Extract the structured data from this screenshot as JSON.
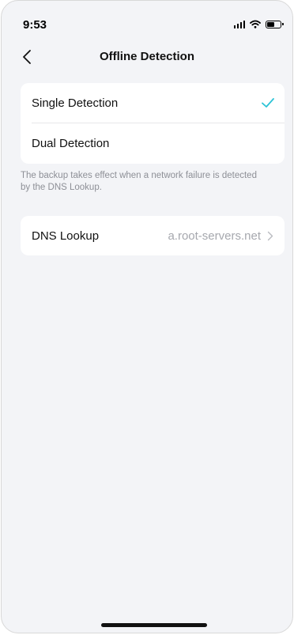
{
  "status_bar": {
    "time": "9:53",
    "icons": [
      "signal-icon",
      "wifi-icon",
      "battery-icon"
    ]
  },
  "nav": {
    "back_icon": "chevron-left-icon",
    "title": "Offline Detection"
  },
  "detection_modes": {
    "items": [
      {
        "label": "Single Detection",
        "selected": true
      },
      {
        "label": "Dual Detection",
        "selected": false
      }
    ],
    "check_color": "#2bc3d6"
  },
  "hint": "The backup takes effect when a network failure is detected by the DNS Lookup.",
  "dns": {
    "label": "DNS Lookup",
    "value": "a.root-servers.net"
  }
}
